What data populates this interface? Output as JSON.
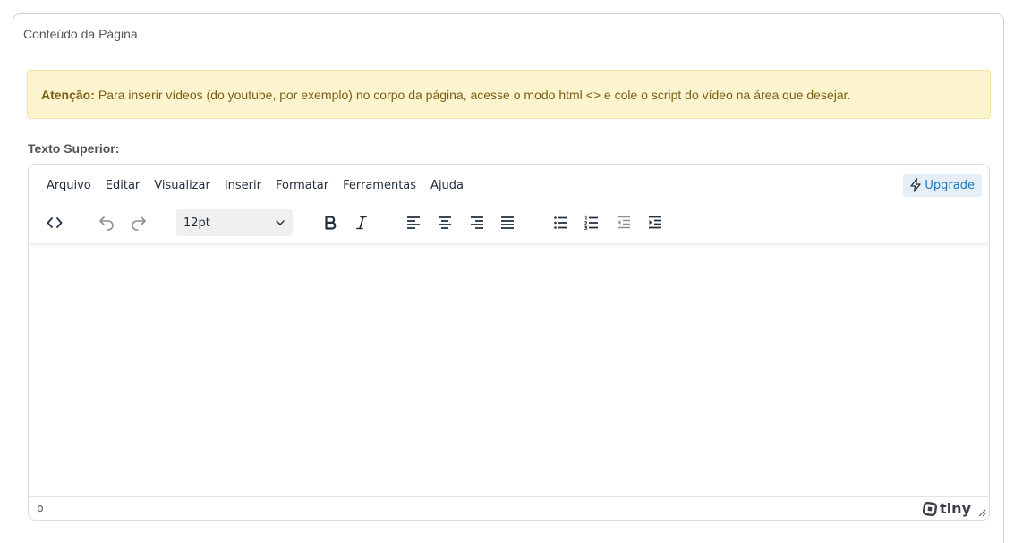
{
  "card": {
    "title": "Conteúdo da Página"
  },
  "alert": {
    "strong": "Atenção:",
    "text": "Para inserir vídeos (do youtube, por exemplo) no corpo da página, acesse o modo html <> e cole o script do vídeo na área que desejar."
  },
  "field": {
    "label": "Texto Superior:"
  },
  "editor": {
    "menu": [
      "Arquivo",
      "Editar",
      "Visualizar",
      "Inserir",
      "Formatar",
      "Ferramentas",
      "Ajuda"
    ],
    "upgrade_label": "Upgrade",
    "font_size": "12pt",
    "status_path": "p",
    "brand": "tiny",
    "toolbar_icons": [
      "source-code-icon",
      "undo-icon",
      "redo-icon",
      "bold-icon",
      "italic-icon",
      "align-left-icon",
      "align-center-icon",
      "align-right-icon",
      "align-justify-icon",
      "bullet-list-icon",
      "numbered-list-icon",
      "outdent-icon",
      "indent-icon"
    ],
    "colors": {
      "icon": "#222f3e",
      "disabled_icon": "#8b9096",
      "upgrade_text": "#207ab7",
      "alert_bg": "#fcf3cf",
      "alert_text": "#7b5f12"
    }
  }
}
